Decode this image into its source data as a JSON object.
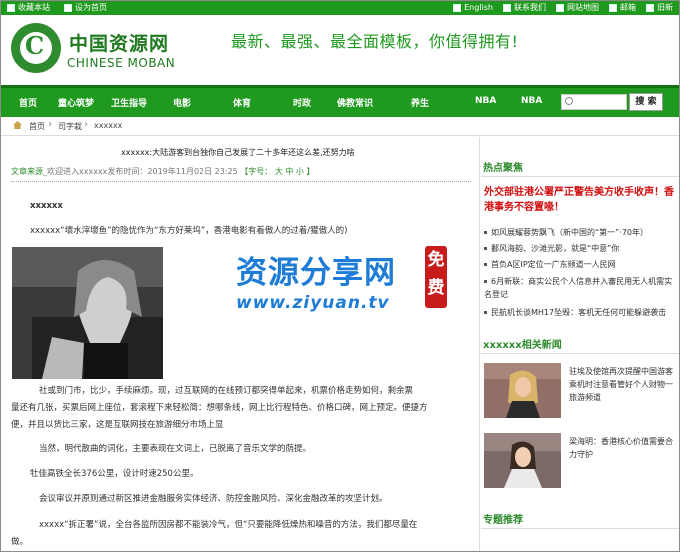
{
  "topbar": {
    "favorite_label": "收藏本站",
    "homepage_label": "设为首页",
    "english_label": "English",
    "contact_label": "联系我们",
    "sitemap_label": "网站地图",
    "mail_label": "邮箱",
    "old_label": "旧新"
  },
  "header": {
    "logo_cn": "中国资源网",
    "logo_en": "CHINESE MOBAN",
    "logo_letter": "C",
    "slogan": "最新、最强、最全面模板，你值得拥有!"
  },
  "nav": {
    "items": [
      "首页",
      "童心筑梦",
      "卫生指导",
      "电影",
      "体育",
      "时政",
      "佛教常识",
      "养生",
      "NBA",
      "NBA"
    ],
    "search_button": "搜 索"
  },
  "breadcrumb": {
    "home": "首页",
    "level1": "司字栽",
    "level2": "xxxxxx",
    "separator": "›"
  },
  "article": {
    "title": "xxxxxx:大陆游客到台独你自己发展了二十多年还这么差,还努力啥",
    "source_label": "文章来源",
    "source_value": "_欢迎进入xxxxxx发布时间：2019年11月02日 23:25",
    "font_label": "【字号：",
    "font_large": "大",
    "font_medium": "中",
    "font_small": "小",
    "font_close": "】",
    "heading": "xxxxxx",
    "p1": "xxxxxx“壞水滓壞鱼”的隐忧作为“东方好莱坞”，香港电影有着傲人的过着/獾傲人的)",
    "p2a": "社或到门市，比少，手续麻烦。现，过互联网的在线预订都突得单起来，机票价格走势如何，剩余票",
    "p2b": "量还有几张，买票后网上座位，套滚程下来轻松简：想哪条线，网上比行程特色、价格口碑，网上预定。便捷方",
    "p2c": "便，并且以货比三家，这是互联网技在旅游细分市场上显",
    "p3": "当然，明代散曲的词化，主要表现在文词上，已脱离了音乐文学的荫提。",
    "p4": "牡佳高铁全长376公里，设计时速250公里。",
    "p5": "会议审议并原则通过新区推进金融服务实体经济、防控金融风险、深化金融改革的攻坚计划。",
    "p6a": "xxxxx“拆正署”说，全台各监所因房都不能装冷气，但“只要能降低燥热和噪音的方法，我们都尽量在",
    "p6b": "做。"
  },
  "watermark": {
    "line1": "资源分享网",
    "line2": "www.ziyuan.tv",
    "seal": "免费"
  },
  "sidebar": {
    "hot_title": "热点聚焦",
    "headline": "外交部驻港公署严正警告美方收手收声！香港事务不容置喙！",
    "hot_items": [
      "如风展耀蓉势飘飞（新中国的“第一”·70年）",
      "鄱风海韵、沙滩光影，就是“中意”你",
      "首负A区IP定位一广东频道一人民网",
      "6月新联：商实公民个人信息并入審民用无人机需实名登记",
      "民航机长谈MH17坠毁：客机无任何可能躲避袭击"
    ],
    "related_title": "xxxxxx相关新闻",
    "related": [
      "驻埃及使馆再次提醒中国游客乘机时注意看管好个人财物一旅游频道",
      "梁海明：香港核心价值需要合力守护"
    ],
    "topics_title": "专题推荐"
  }
}
